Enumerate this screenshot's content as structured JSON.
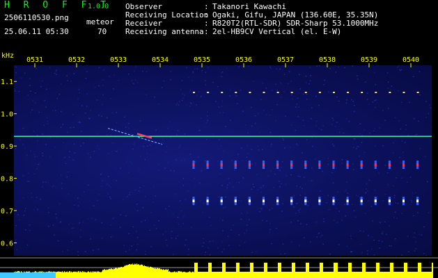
{
  "header": {
    "app_name": "H R O F F T",
    "version": "1.0.0",
    "filename": "2506110530.png",
    "datetime": "25.06.11 05:30",
    "meteor_label": "meteor",
    "meteor_count": "70"
  },
  "station": [
    {
      "key": "Observer",
      "value": "Takanori Kawachi"
    },
    {
      "key": "Receiving Location",
      "value": "Ogaki, Gifu, JAPAN (136.60E, 35.35N)"
    },
    {
      "key": "Receiver",
      "value": "R820T2(RTL-SDR) SDR-Sharp 53.1000MHz"
    },
    {
      "key": "Receiving antenna",
      "value": "2el-HB9CV Vertical (el. E-W)"
    }
  ],
  "colors": {
    "header_green": "#00ff00",
    "header_white": "#ffffff",
    "axis_yellow": "#ffff00",
    "spectrogram_bg": "#0b1058",
    "carrier_line": "#40e0a0",
    "signal_bar": "#ffff00"
  },
  "chart_data": {
    "type": "heatmap",
    "ylabel": "kHz",
    "time_ticks": [
      "0531",
      "0532",
      "0533",
      "0534",
      "0535",
      "0536",
      "0537",
      "0538",
      "0539",
      "0540"
    ],
    "time_range_min": [
      0,
      10
    ],
    "freq_ticks": [
      "1.1",
      "1.0",
      "0.9",
      "0.8",
      "0.7",
      "0.6"
    ],
    "freq_range_khz": [
      0.56,
      1.15
    ],
    "carrier_freq_khz": 0.93,
    "meteor_echo": {
      "start_min": 2.25,
      "end_min": 3.55,
      "freq_start_khz": 0.955,
      "freq_end_khz": 0.905
    },
    "periodic_tone_rows_khz": [
      1.066,
      0.842,
      0.73
    ],
    "periodic_start_min": 4.3,
    "periodic_interval_min": 0.335
  }
}
